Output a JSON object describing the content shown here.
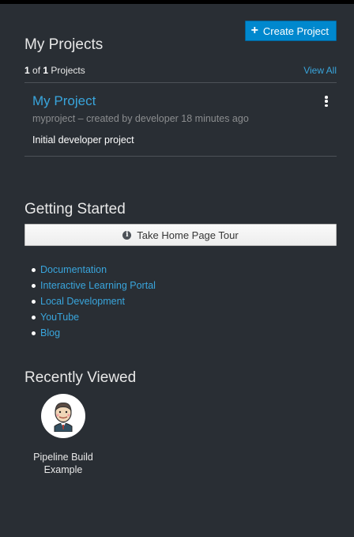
{
  "header": {
    "title": "My Projects",
    "create_label": "Create Project"
  },
  "projects": {
    "count_current": "1",
    "count_of": "of",
    "count_total": "1",
    "count_suffix": "Projects",
    "view_all": "View All",
    "items": [
      {
        "name": "My Project",
        "meta": "myproject – created by developer 18 minutes ago",
        "description": "Initial developer project"
      }
    ]
  },
  "getting_started": {
    "title": "Getting Started",
    "tour_label": "Take Home Page Tour",
    "links": [
      "Documentation",
      "Interactive Learning Portal",
      "Local Development",
      "YouTube",
      "Blog"
    ]
  },
  "recently_viewed": {
    "title": "Recently Viewed",
    "items": [
      {
        "label_line1": "Pipeline Build",
        "label_line2": "Example",
        "icon": "jenkins-icon"
      }
    ]
  },
  "colors": {
    "background": "#292e34",
    "link": "#39a5dc",
    "primary_button": "#0088ce"
  }
}
